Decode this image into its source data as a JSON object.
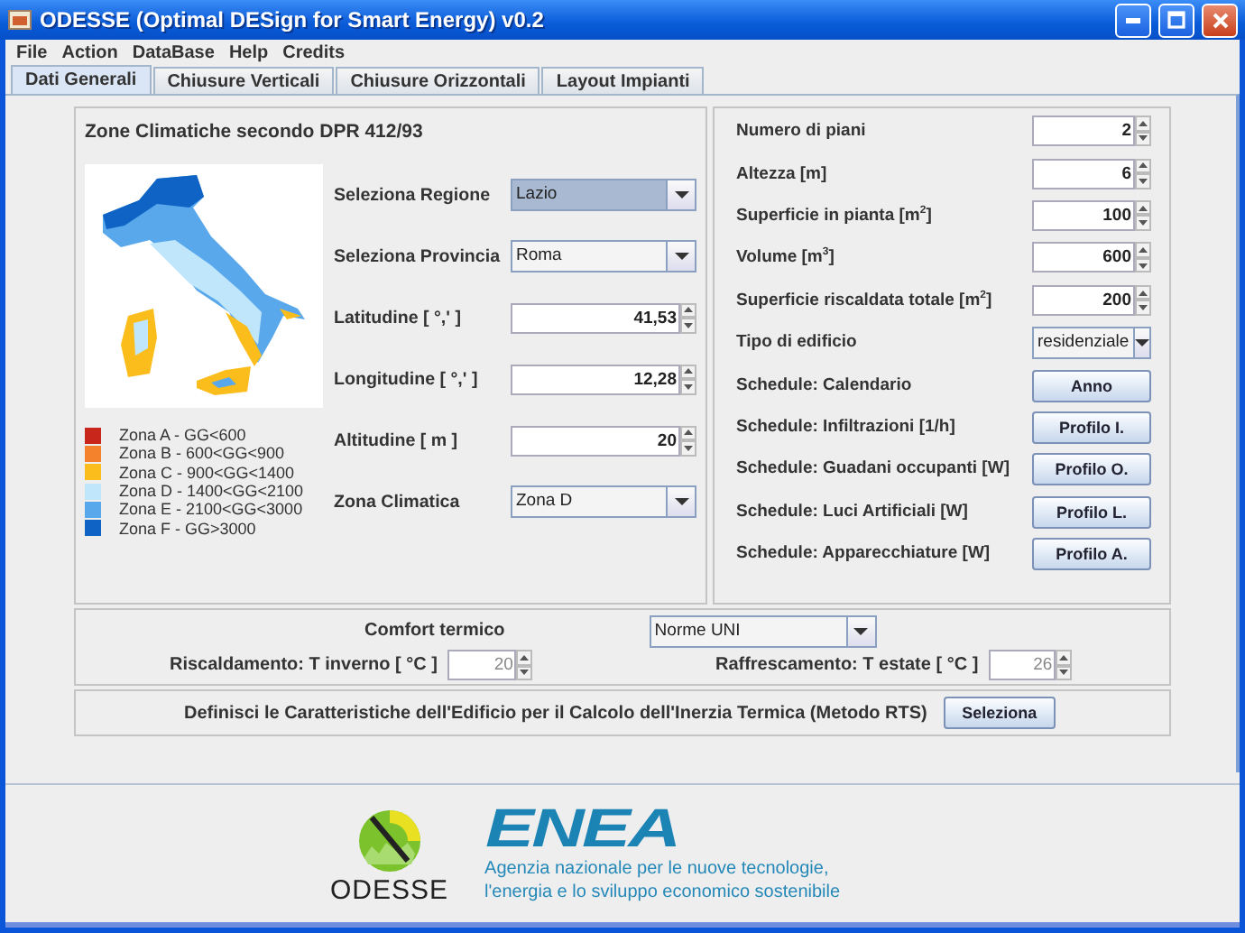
{
  "window": {
    "title": "ODESSE (Optimal DESign for Smart Energy) v0.2"
  },
  "menu": [
    "File",
    "Action",
    "DataBase",
    "Help",
    "Credits"
  ],
  "tabs": [
    {
      "label": "Dati Generali",
      "selected": true
    },
    {
      "label": "Chiusure Verticali",
      "selected": false
    },
    {
      "label": "Chiusure Orizzontali",
      "selected": false
    },
    {
      "label": "Layout Impianti",
      "selected": false
    }
  ],
  "climate_panel": {
    "title": "Zone Climatiche secondo DPR 412/93",
    "legend": [
      {
        "label": "Zona A - GG<600",
        "color": "#c8261a"
      },
      {
        "label": "Zona B - 600<GG<900",
        "color": "#f4812c"
      },
      {
        "label": "Zona C - 900<GG<1400",
        "color": "#fbbd1c"
      },
      {
        "label": "Zona D - 1400<GG<2100",
        "color": "#bfe6fb"
      },
      {
        "label": "Zona E - 2100<GG<3000",
        "color": "#5aa8ec"
      },
      {
        "label": "Zona F - GG>3000",
        "color": "#0f63c4"
      }
    ],
    "fields": [
      {
        "kind": "dropdown",
        "label": "Seleziona Regione",
        "value": "Lazio",
        "focused": true
      },
      {
        "kind": "dropdown",
        "label": "Seleziona Provincia",
        "value": "Roma",
        "focused": false
      },
      {
        "kind": "spinner",
        "label": "Latitudine [ °,' ]",
        "value": "41,53",
        "focused": false
      },
      {
        "kind": "spinner",
        "label": "Longitudine [ °,' ]",
        "value": "12,28",
        "focused": false
      },
      {
        "kind": "spinner",
        "label": "Altitudine [ m ]",
        "value": "20",
        "focused": false
      },
      {
        "kind": "dropdown",
        "label": "Zona Climatica",
        "value": "Zona D",
        "focused": false
      }
    ]
  },
  "building_panel": [
    {
      "kind": "spinner",
      "label": "Numero di piani",
      "value": "2"
    },
    {
      "kind": "spinner",
      "label": "Altezza [m]",
      "value": "6"
    },
    {
      "kind": "spinner",
      "label": "Superficie in pianta [m$^{2}$]",
      "value": "100"
    },
    {
      "kind": "spinner",
      "label": "Volume [m$^{3}$]",
      "value": "600"
    },
    {
      "kind": "spinner",
      "label": "Superficie riscaldata totale [m$^{2}$]",
      "value": "200"
    },
    {
      "kind": "dropdown",
      "label": "Tipo di edificio",
      "value": "residenziale"
    },
    {
      "kind": "button",
      "label": "Schedule: Calendario",
      "value": "Anno"
    },
    {
      "kind": "button",
      "label": "Schedule: Infiltrazioni [1/h]",
      "value": "Profilo I."
    },
    {
      "kind": "button",
      "label": "Schedule: Guadani occupanti [W]",
      "value": "Profilo O."
    },
    {
      "kind": "button",
      "label": "Schedule: Luci Artificiali [W]",
      "value": "Profilo L."
    },
    {
      "kind": "button",
      "label": "Schedule: Apparecchiature [W]",
      "value": "Profilo A."
    }
  ],
  "comfort": {
    "label": "Comfort termico",
    "standard": "Norme UNI",
    "heating": {
      "label": "Riscaldamento: T inverno [ °C ]",
      "value": "20",
      "disabled": true
    },
    "cooling": {
      "label": "Raffrescamento: T estate [ °C ]",
      "value": "26",
      "disabled": true
    }
  },
  "rts": {
    "text": "Definisci le Caratteristiche dell'Edificio per il Calcolo dell'Inerzia Termica (Metodo RTS)",
    "button": "Seleziona"
  },
  "footer": {
    "odesse_logo": "ODESSE",
    "enea_logo": "ENEA",
    "tagline": [
      "Agenzia nazionale per le nuove tecnologie,",
      "l'energia e lo sviluppo economico sostenibile"
    ]
  }
}
